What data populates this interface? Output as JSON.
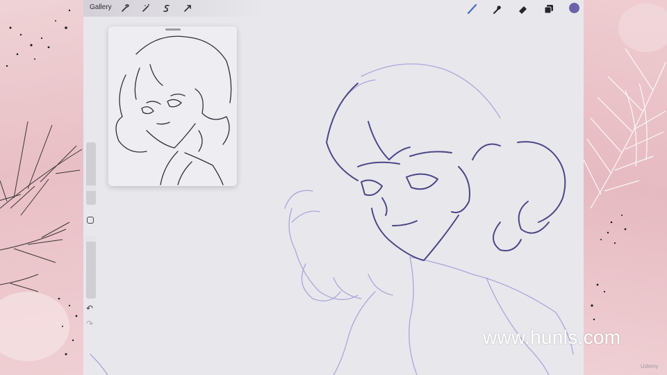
{
  "toolbar": {
    "gallery_label": "Gallery",
    "left_tools": [
      "wrench-icon",
      "magic-wand-icon",
      "selection-icon",
      "transform-icon"
    ],
    "right_tools": [
      "brush-icon",
      "smudge-icon",
      "eraser-icon",
      "layers-icon"
    ],
    "active_color": "#6a63ab"
  },
  "sidebar": {
    "brush_size": 0.55,
    "opacity": 0.0
  },
  "watermark": "www.hunls.com",
  "corner_tag": "Udemy",
  "colors": {
    "stroke_dark": "#4a4687",
    "stroke_light": "#a9a6d6",
    "ref_stroke": "#2f2d3a"
  }
}
